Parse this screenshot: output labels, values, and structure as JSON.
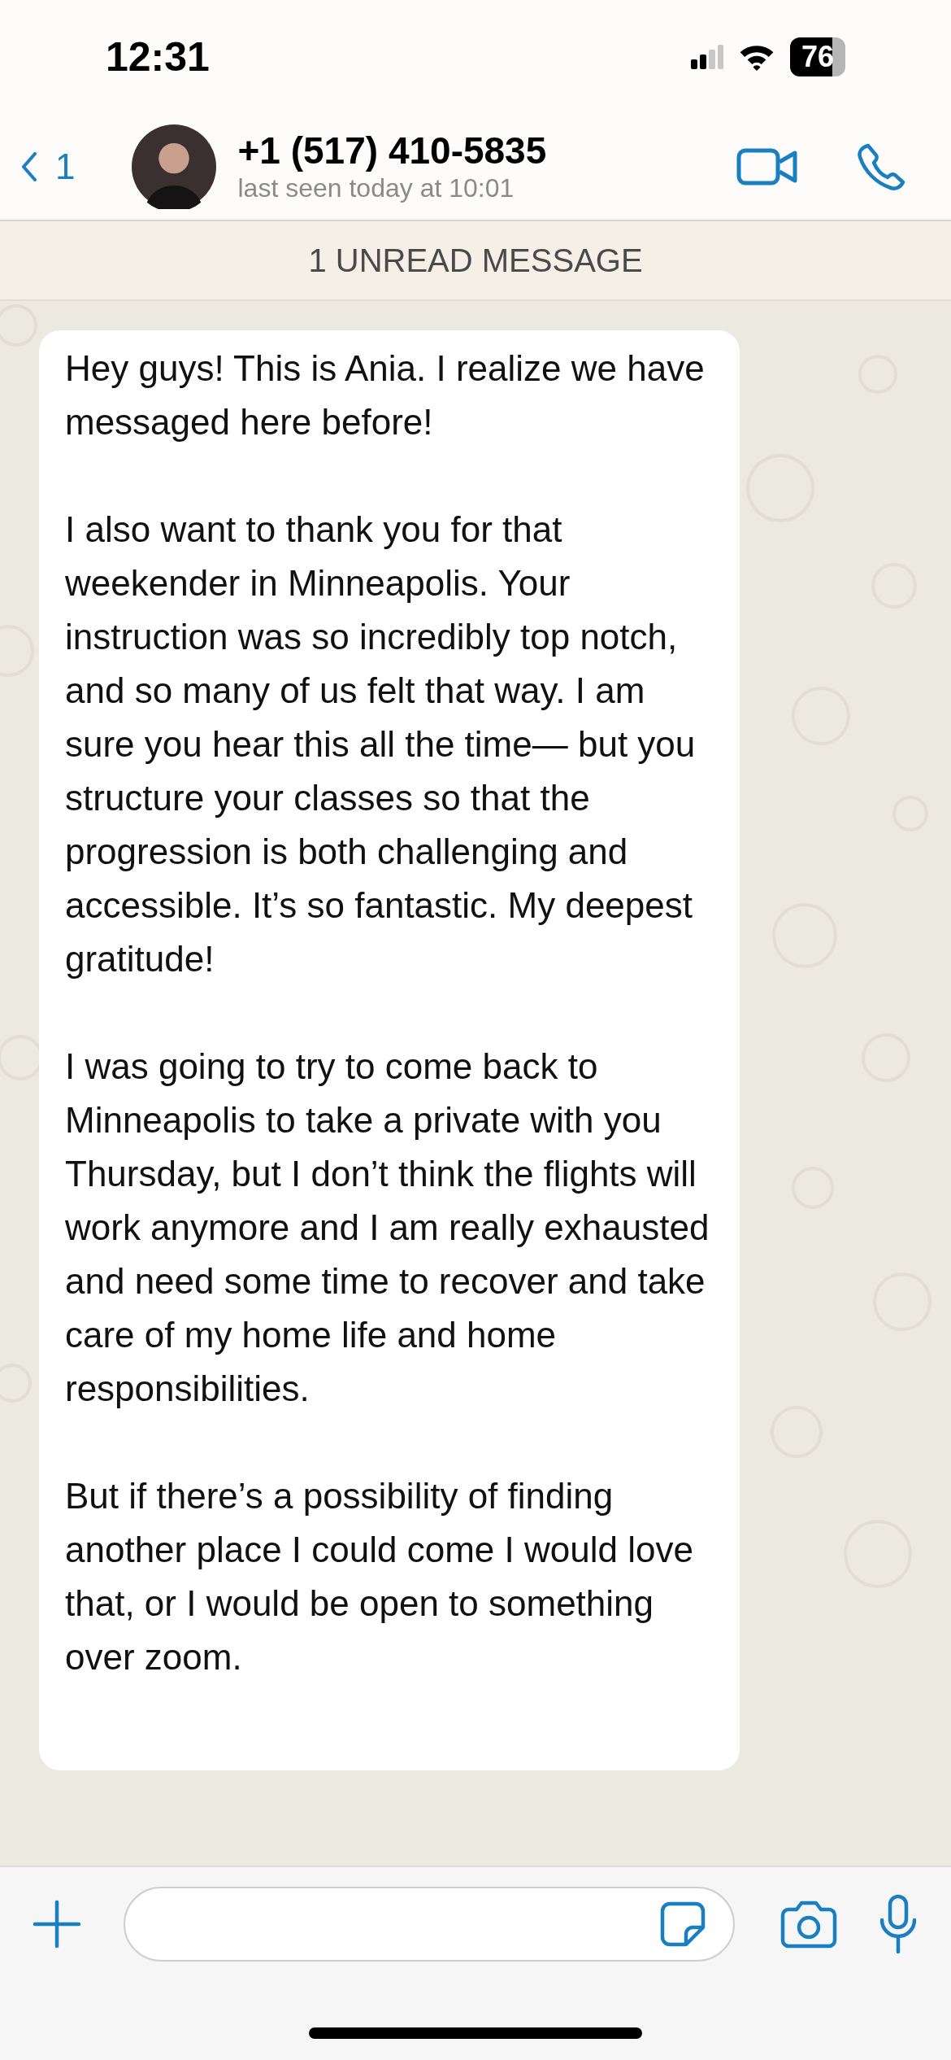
{
  "status_bar": {
    "time": "12:31",
    "battery": "76"
  },
  "header": {
    "back_count": "1",
    "contact_name": "+1 (517) 410-5835",
    "last_seen": "last seen today at 10:01"
  },
  "unread_banner": "1 UNREAD MESSAGE",
  "message": {
    "paragraphs": [
      "Hey guys! This is Ania. I realize we have messaged here before!",
      "I also want to thank you for that weekender in Minneapolis. Your instruction was so incredibly top notch, and so many of us felt that way. I am sure you hear this all the time— but you structure your classes so that the progression is both challenging and accessible. It’s so fantastic. My deepest gratitude!",
      "I was going to try to come back to Minneapolis to take a private with you Thursday, but I don’t think the flights will work anymore and I am really exhausted and need some time to recover and take care of my home life and home responsibilities.",
      "But if there’s a possibility of finding another place I could come I would love that, or I would be open to something over zoom."
    ]
  }
}
